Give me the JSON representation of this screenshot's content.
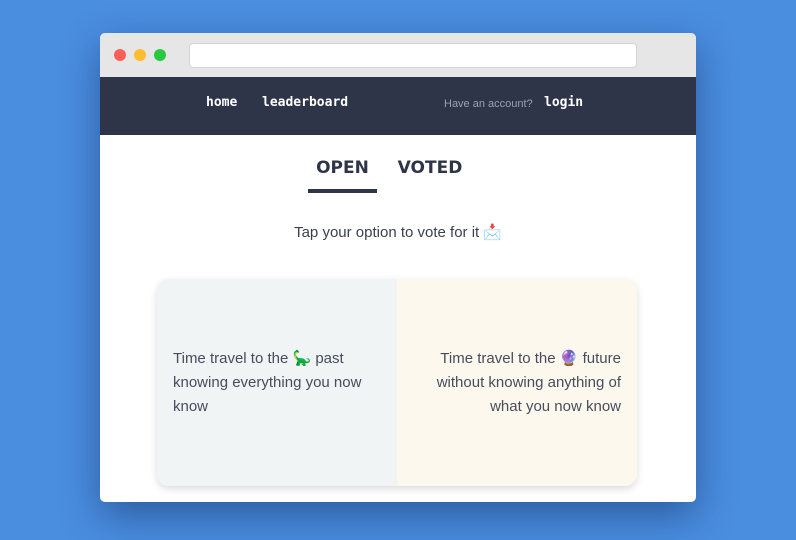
{
  "browser": {
    "address": ""
  },
  "nav": {
    "home": "home",
    "leaderboard": "leaderboard",
    "account_prompt": "Have an account?",
    "login": "login"
  },
  "tabs": [
    {
      "label": "OPEN",
      "active": true
    },
    {
      "label": "VOTED",
      "active": false
    }
  ],
  "instruction": {
    "text": "Tap your option to vote for it",
    "emoji": "📩"
  },
  "options": [
    {
      "text": "Time travel to the 🦕 past knowing everything you now know"
    },
    {
      "text": "Time travel to the 🔮 future without knowing anything of what you now know"
    }
  ],
  "colors": {
    "page_background": "#4a8ee0",
    "navbar": "#2f3549",
    "option_left_bg": "#f0f4f5",
    "option_right_bg": "#fdf8ed"
  }
}
